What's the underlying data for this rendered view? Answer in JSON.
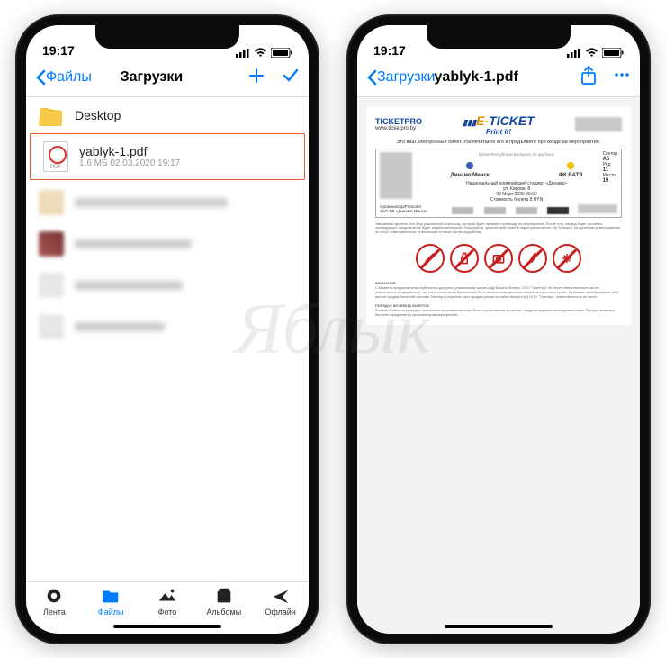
{
  "watermark": "Яблык",
  "status": {
    "time": "19:17"
  },
  "left": {
    "back": "Файлы",
    "title": "Загрузки",
    "folder": "Desktop",
    "file": {
      "name": "yablyk-1.pdf",
      "meta": "1.6 МБ  02.03.2020 19:17"
    },
    "tabs": [
      "Лента",
      "Файлы",
      "Фото",
      "Альбомы",
      "Офлайн"
    ]
  },
  "right": {
    "back": "Загрузки",
    "title": "yablyk-1.pdf",
    "doc": {
      "ticketpro": "TICKETPRO",
      "ticketpro_sub": "www.ticketpro.by",
      "eticket_e": "E-",
      "eticket_rest": "TICKET",
      "printit": "Print it!",
      "subtitle": "Это ваш электронный билет. Распечатайте его и предъявите при входе на мероприятие.",
      "cup": "Кубок Республики Беларусь по футболу",
      "team1": "Динамо Минск",
      "team2": "ФК БАТЭ",
      "venue": "Национальный олимпийский стадион «Динамо»",
      "address": "ул. Кирова, 8",
      "date": "09 Март 2020 20:00",
      "price": "Стоимость билета  8  BYN",
      "sector_lbl": "Сектор",
      "sector": "A5",
      "row_lbl": "Ряд",
      "row": "11",
      "seat_lbl": "Место",
      "seat": "19",
      "org_lbl": "Организатор/Promoter",
      "org": "ЗАО ФК «Динамо-Минск»",
      "warn_hdr": "ВНИМАНИЕ!",
      "return_hdr": "ПОРЯДОК ВОЗВРАТА БИЛЕТОВ"
    }
  }
}
